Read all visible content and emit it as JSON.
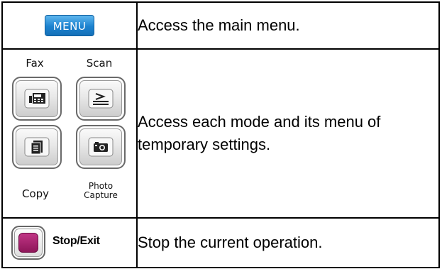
{
  "rows": [
    {
      "button_label": "MENU",
      "description": "Access the main menu."
    },
    {
      "modes": {
        "fax": "Fax",
        "scan": "Scan",
        "copy": "Copy",
        "photo_line1": "Photo",
        "photo_line2": "Capture"
      },
      "description": "Access each mode and its menu of temporary settings."
    },
    {
      "button_label": "Stop/Exit",
      "description": "Stop the current operation."
    }
  ],
  "colors": {
    "menu_button": "#1c82cf",
    "stop_button": "#a0226c"
  },
  "icons": [
    "fax-icon",
    "scan-icon",
    "copy-icon",
    "photo-capture-icon",
    "stop-icon"
  ]
}
